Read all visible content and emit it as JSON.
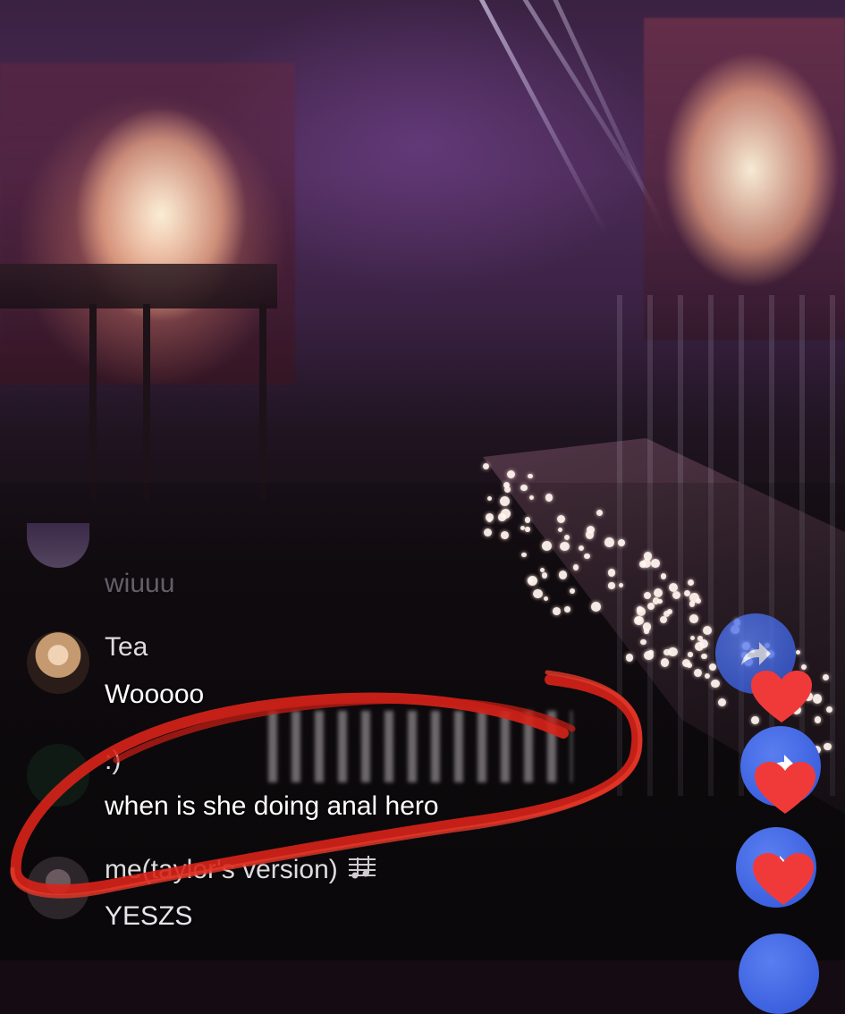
{
  "comments": [
    {
      "username": "",
      "message": "wiuuu"
    },
    {
      "username": "Tea",
      "message": "Wooooo"
    },
    {
      "username": ":)",
      "message": "when is she doing anal hero"
    },
    {
      "username": "me(taylor's version)",
      "message": "YESZS"
    }
  ],
  "badge_icon": "music-notes-icon",
  "colors": {
    "annotation": "#d8241a",
    "share_button": "#3a5ee0",
    "heart": "#f03a3a"
  }
}
